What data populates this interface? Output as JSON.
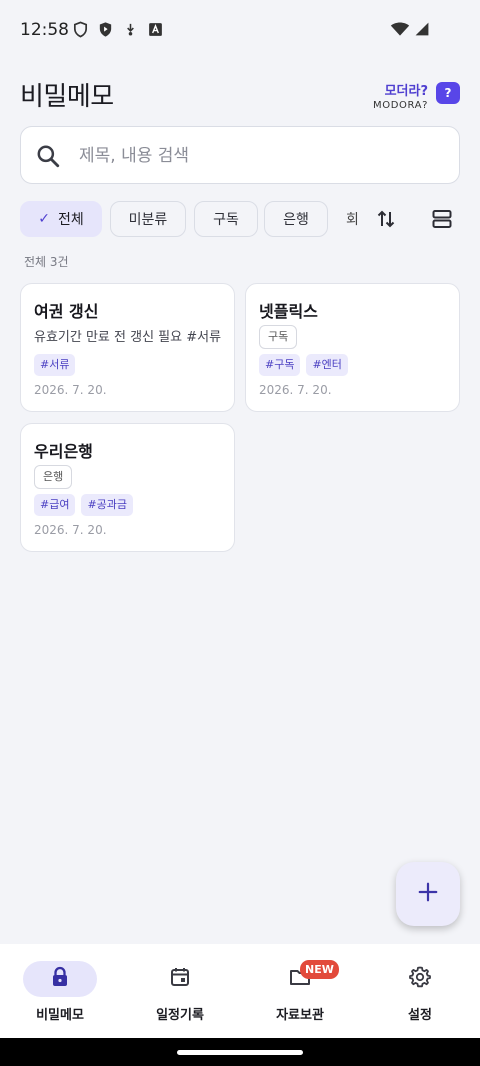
{
  "status": {
    "time": "12:58"
  },
  "header": {
    "title": "비밀메모",
    "help_ko": "모더라?",
    "help_en": "MODORA?",
    "help_icon": "?"
  },
  "search": {
    "placeholder": "제목, 내용 검색"
  },
  "filters": {
    "all": "전체",
    "uncategorized": "미분류",
    "subscription": "구독",
    "bank": "은행",
    "more_fragment": "회"
  },
  "count_label": "전체 3건",
  "cards": [
    {
      "title": "여권 갱신",
      "desc": "유효기간 만료 전 갱신 필요 #서류",
      "tags": [
        "#서류"
      ],
      "date": "2026. 7. 20."
    },
    {
      "title": "넷플릭스",
      "category": "구독",
      "tags": [
        "#구독",
        "#엔터"
      ],
      "date": "2026. 7. 20."
    },
    {
      "title": "우리은행",
      "category": "은행",
      "tags": [
        "#급여",
        "#공과금"
      ],
      "date": "2026. 7. 20."
    }
  ],
  "nav": {
    "memo": "비밀메모",
    "schedule": "일정기록",
    "storage": "자료보관",
    "settings": "설정",
    "new_badge": "NEW"
  },
  "colors": {
    "accent": "#5846e8",
    "accent_soft": "#e6e5fb",
    "badge_red": "#e24a3b",
    "background": "#f3f4f8"
  }
}
